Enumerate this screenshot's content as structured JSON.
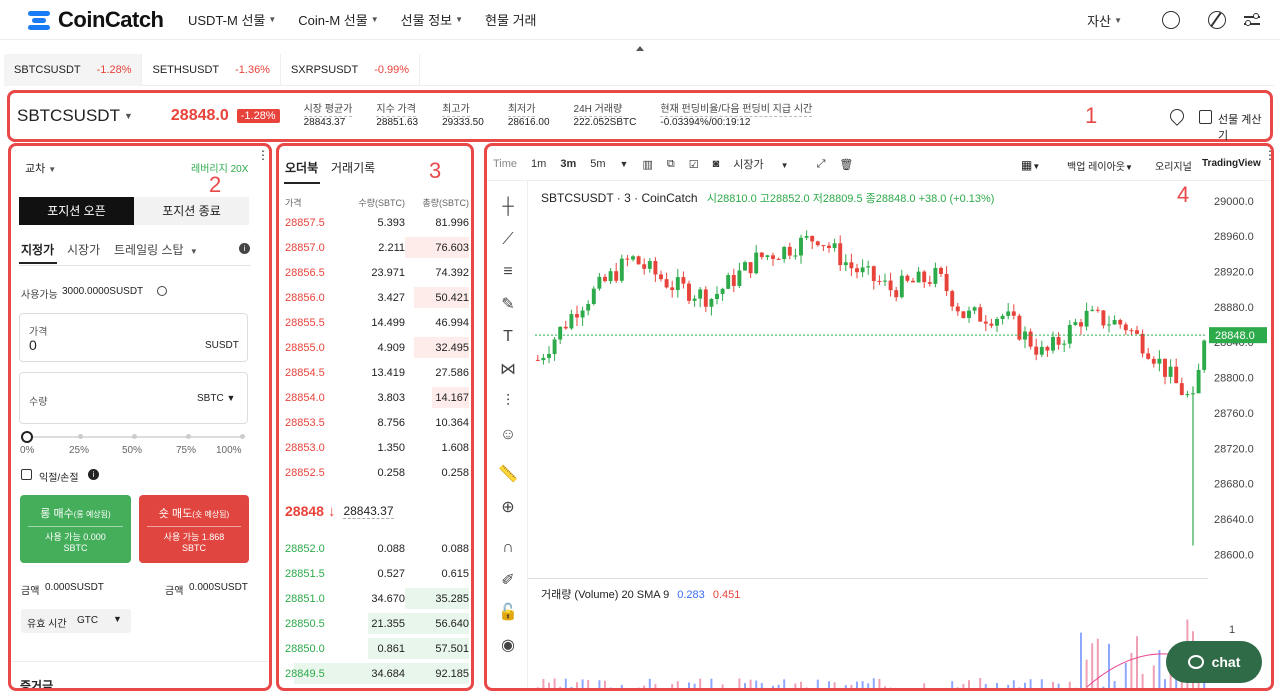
{
  "nav": {
    "logo": "CoinCatch",
    "items": [
      "USDT-M 선물",
      "Coin-M 선물",
      "선물 정보",
      "현물 거래"
    ],
    "asset": "자산"
  },
  "symtabs": [
    {
      "name": "SBTCSUSDT",
      "pct": "-1.28%"
    },
    {
      "name": "SETHSUSDT",
      "pct": "-1.36%"
    },
    {
      "name": "SXRPSUSDT",
      "pct": "-0.99%"
    }
  ],
  "ticker": {
    "symbol": "SBTCSUSDT",
    "price": "28848.0",
    "pct": "-1.28%",
    "stats": [
      {
        "label": "시장 평균가",
        "value": "28843.37"
      },
      {
        "label": "지수 가격",
        "value": "28851.63"
      },
      {
        "label": "최고가",
        "value": "29333.50"
      },
      {
        "label": "최저가",
        "value": "28616.00"
      },
      {
        "label": "24H 거래량",
        "value": "222.052SBTC"
      },
      {
        "label": "현재 펀딩비율/다음 펀딩비 지급 시간",
        "value": "-0.03394%/00:19:12"
      }
    ],
    "calc": "선물 계산기",
    "box_label": "1"
  },
  "orderform": {
    "box_label": "2",
    "margin_mode": "교차",
    "leverage": "레버리지 20X",
    "open": "포지션 오픈",
    "close": "포지션 종료",
    "types": [
      "지정가",
      "시장가",
      "트레일링 스탑"
    ],
    "available_label": "사용가능",
    "available_value": "3000.0000SUSDT",
    "price_label": "가격",
    "price_value": "0",
    "price_unit": "SUSDT",
    "qty_label": "수량",
    "qty_unit": "SBTC",
    "slider_marks": [
      "0%",
      "25%",
      "50%",
      "75%",
      "100%"
    ],
    "slider_value": 0,
    "tpsl": "익절/손절",
    "long_title": "롱 매수",
    "long_sub": "(롱 예상됨)",
    "long_avail": "사용 가능 0.000",
    "long_unit": "SBTC",
    "short_title": "숏 매도",
    "short_sub": "(숏 예상됨)",
    "short_avail": "사용 가능 1.868",
    "short_unit": "SBTC",
    "amount_label": "금액",
    "amount_long": "0.000SUSDT",
    "amount_short": "0.000SUSDT",
    "tif_label": "유효 시간",
    "tif_value": "GTC",
    "margin": "증거금"
  },
  "orderbook": {
    "box_label": "3",
    "tabs": [
      "오더북",
      "거래기록"
    ],
    "headers": [
      "가격",
      "수량(SBTC)",
      "총량(SBTC)"
    ],
    "asks": [
      [
        "28857.5",
        "5.393",
        "81.996",
        0.0
      ],
      [
        "28857.0",
        "2.211",
        "76.603",
        0.35
      ],
      [
        "28856.5",
        "23.971",
        "74.392",
        0.0
      ],
      [
        "28856.0",
        "3.427",
        "50.421",
        0.3
      ],
      [
        "28855.5",
        "14.499",
        "46.994",
        0.0
      ],
      [
        "28855.0",
        "4.909",
        "32.495",
        0.3
      ],
      [
        "28854.5",
        "13.419",
        "27.586",
        0.0
      ],
      [
        "28854.0",
        "3.803",
        "14.167",
        0.2
      ],
      [
        "28853.5",
        "8.756",
        "10.364",
        0.0
      ],
      [
        "28853.0",
        "1.350",
        "1.608",
        0.0
      ],
      [
        "28852.5",
        "0.258",
        "0.258",
        0.0
      ]
    ],
    "mid_price": "28848",
    "mid_mark": "28843.37",
    "bids": [
      [
        "28852.0",
        "0.088",
        "0.088",
        0.0
      ],
      [
        "28851.5",
        "0.527",
        "0.615",
        0.0
      ],
      [
        "28851.0",
        "34.670",
        "35.285",
        0.35
      ],
      [
        "28850.5",
        "21.355",
        "56.640",
        0.55
      ],
      [
        "28850.0",
        "0.861",
        "57.501",
        0.55
      ],
      [
        "28849.5",
        "34.684",
        "92.185",
        0.95
      ]
    ]
  },
  "chart": {
    "box_label": "4",
    "toolbar": [
      "Time",
      "1m",
      "3m",
      "5m"
    ],
    "indicator": "시장가",
    "layout": "백업 레이아웃",
    "original": "오리지널",
    "tradingview": "TradingView",
    "legend_symbol": "SBTCSUSDT · 3 · CoinCatch",
    "ohlc": "시28810.0 고28852.0 저28809.5 종28848.0 +38.0 (+0.13%)",
    "price_ticks": [
      "29000.0",
      "28960.0",
      "28920.0",
      "28880.0",
      "28840.0",
      "28800.0",
      "28760.0",
      "28720.0",
      "28680.0",
      "28640.0",
      "28600.0"
    ],
    "ylim": [
      28580,
      29010
    ],
    "last_price": "28848.0",
    "volume_label": "거래량 (Volume) 20 SMA 9",
    "vol_a": "0.283",
    "vol_b": "0.451",
    "vol_tick": "1",
    "colors": {
      "up": "#2daa4a",
      "down": "#e8433b"
    }
  },
  "chat": "chat"
}
